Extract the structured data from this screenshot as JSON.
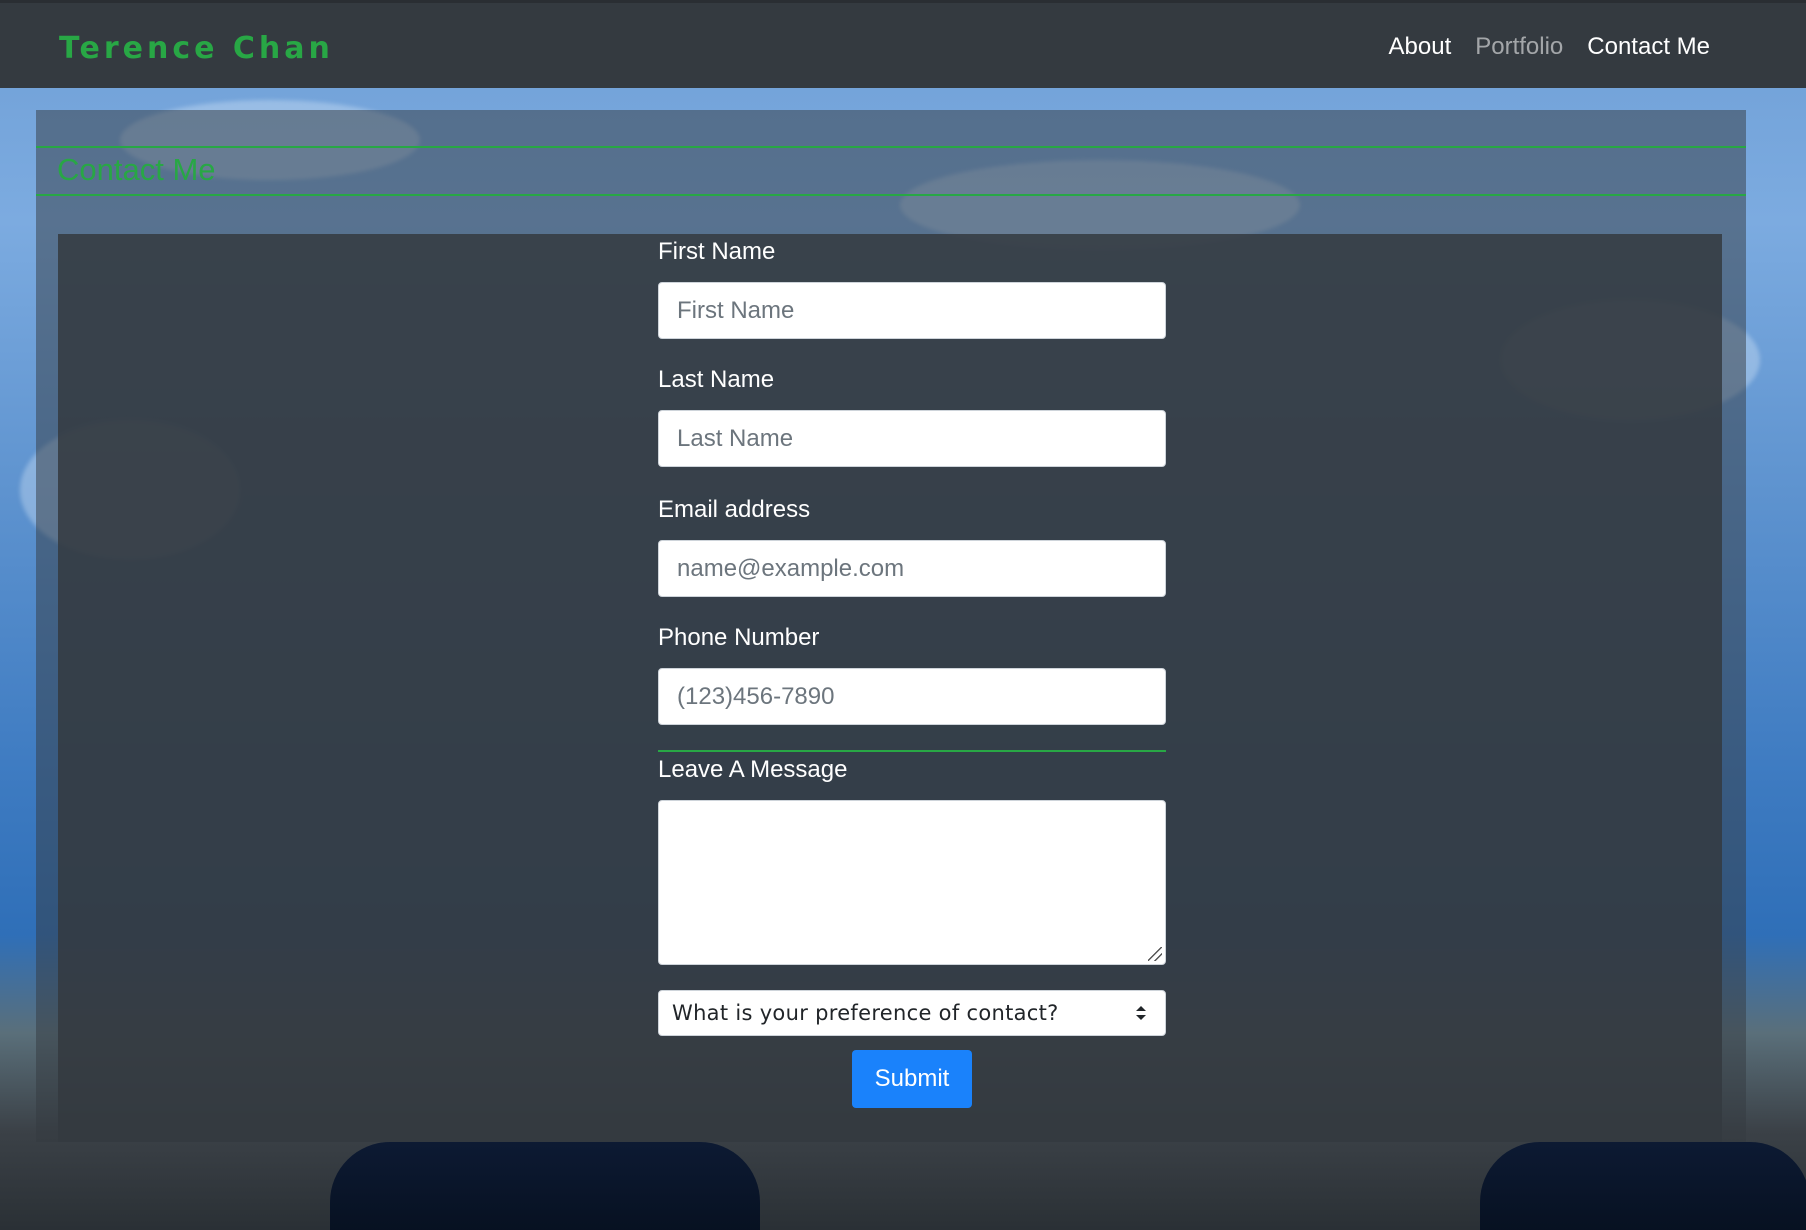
{
  "brand": "Terence Chan",
  "nav": {
    "items": [
      {
        "label": "About",
        "active": false
      },
      {
        "label": "Portfolio",
        "active": true
      },
      {
        "label": "Contact Me",
        "active": false
      }
    ]
  },
  "section": {
    "title": "Contact Me"
  },
  "form": {
    "first_name": {
      "label": "First Name",
      "placeholder": "First Name"
    },
    "last_name": {
      "label": "Last Name",
      "placeholder": "Last Name"
    },
    "email": {
      "label": "Email address",
      "placeholder": "name@example.com"
    },
    "phone": {
      "label": "Phone Number",
      "placeholder": "(123)456-7890"
    },
    "message": {
      "label": "Leave A Message",
      "value": ""
    },
    "preference": {
      "selected": "What is your preference of contact?"
    },
    "submit_label": "Submit"
  },
  "colors": {
    "accent": "#28a745",
    "navbar": "#343a40",
    "button": "#1a82fb"
  }
}
